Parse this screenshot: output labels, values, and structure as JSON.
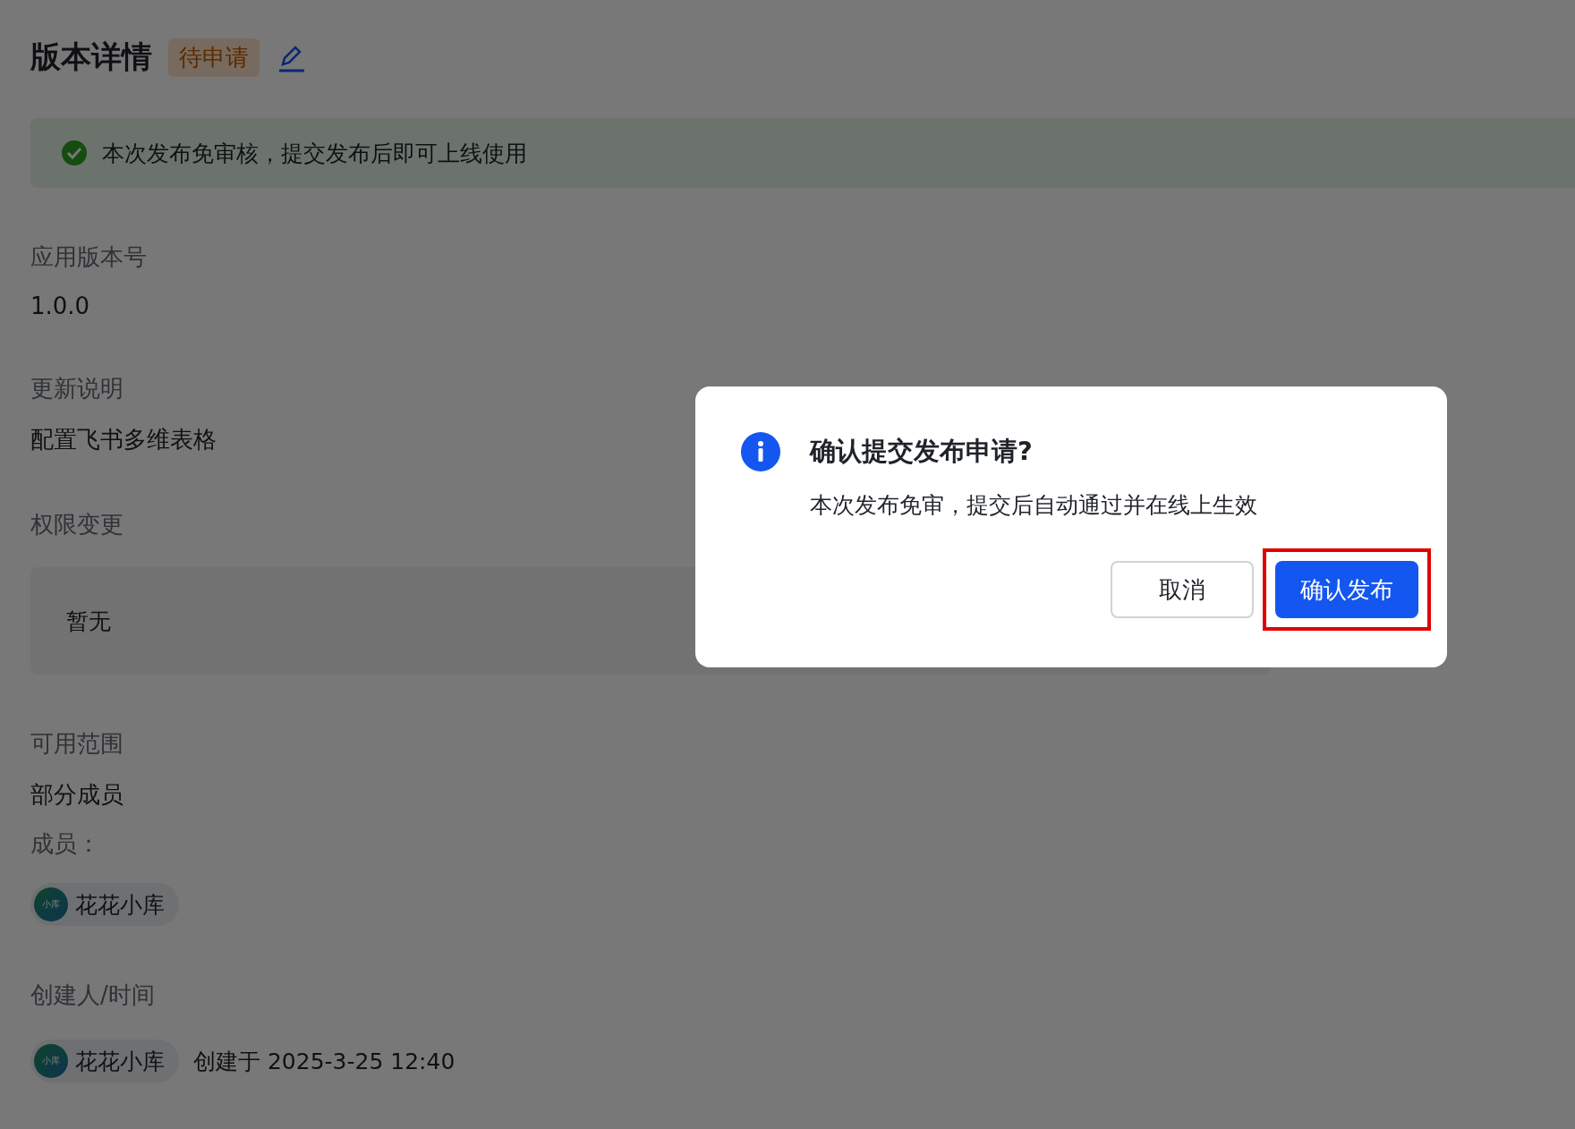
{
  "header": {
    "title": "版本详情",
    "status_tag": "待申请"
  },
  "alert": {
    "text": "本次发布免审核，提交发布后即可上线使用"
  },
  "fields": [
    {
      "label": "应用版本号",
      "value": "1.0.0"
    },
    {
      "label": "更新说明",
      "value": "配置飞书多维表格"
    }
  ],
  "permissions": {
    "label": "权限变更",
    "value": "暂无"
  },
  "scope": {
    "label": "可用范围",
    "value": "部分成员",
    "members_label": "成员：",
    "members": [
      {
        "avatar_text": "小库",
        "name": "花花小库"
      }
    ]
  },
  "creator": {
    "label": "创建人/时间",
    "avatar_text": "小库",
    "name": "花花小库",
    "created": "创建于 2025-3-25 12:40"
  },
  "dialog": {
    "title": "确认提交发布申请?",
    "message": "本次发布免审，提交后自动通过并在线上生效",
    "buttons": [
      {
        "label": "取消",
        "kind": "secondary",
        "highlighted": false
      },
      {
        "label": "确认发布",
        "kind": "primary",
        "highlighted": true
      }
    ]
  }
}
